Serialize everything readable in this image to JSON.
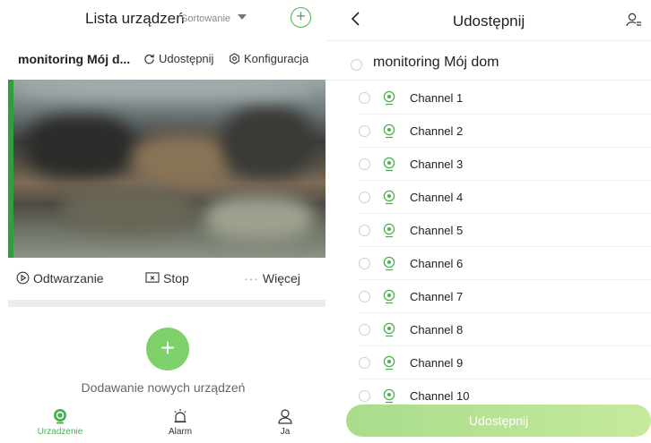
{
  "left": {
    "header": {
      "title": "Lista urządzeń",
      "sort_label": "Sortowanie"
    },
    "device": {
      "name": "monitoring Mój d...",
      "share_label": "Udostępnij",
      "config_label": "Konfiguracja"
    },
    "controls": {
      "playback_label": "Odtwarzanie",
      "stop_label": "Stop",
      "more_label": "Więcej"
    },
    "add_device_label": "Dodawanie nowych urządzeń",
    "tabbar": [
      {
        "label": "Urzadzenie",
        "active": true
      },
      {
        "label": "Alarm",
        "active": false
      },
      {
        "label": "Ja",
        "active": false
      }
    ]
  },
  "right": {
    "header": {
      "title": "Udostępnij"
    },
    "root_device": "monitoring Mój dom",
    "channels": [
      "Channel 1",
      "Channel 2",
      "Channel 3",
      "Channel 4",
      "Channel 5",
      "Channel 6",
      "Channel 7",
      "Channel 8",
      "Channel 9",
      "Channel 10"
    ],
    "share_button_label": "Udostępnij"
  },
  "colors": {
    "accent": "#4caf50",
    "add_button": "#7ed06a",
    "share_button": "#b6e294"
  }
}
